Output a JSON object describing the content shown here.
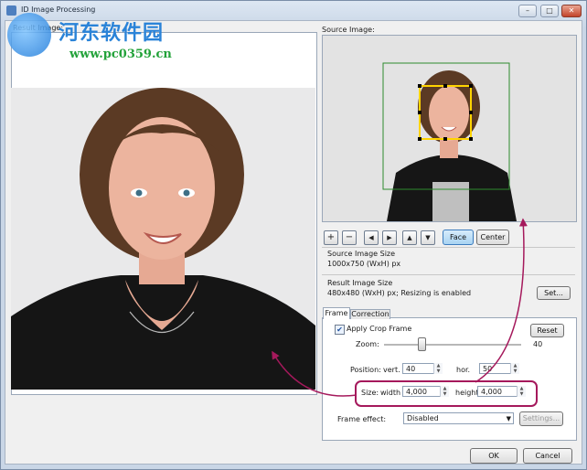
{
  "window": {
    "title": "ID Image Processing",
    "min_label": "–",
    "max_label": "□",
    "close_label": "✕"
  },
  "watermark": {
    "site_name": "河东软件园",
    "url": "www.pc0359.cn"
  },
  "result_panel": {
    "label": "Result Image:"
  },
  "source_panel": {
    "label": "Source Image:"
  },
  "toolbar": {
    "zoom_in": "+",
    "zoom_out": "−",
    "left": "◀",
    "right": "▶",
    "up": "▲",
    "down": "▼",
    "face": "Face",
    "center": "Center"
  },
  "source_size": {
    "label": "Source Image Size",
    "value": "1000x750 (WxH) px"
  },
  "result_size": {
    "label": "Result Image Size",
    "value": "480x480 (WxH) px; Resizing is enabled",
    "set_button": "Set..."
  },
  "tabs": [
    {
      "label": "Frame"
    },
    {
      "label": "Correction"
    }
  ],
  "frame": {
    "apply_crop_label": "Apply Crop Frame",
    "apply_crop_checked": true,
    "reset_button": "Reset",
    "zoom_label": "Zoom:",
    "zoom_value": "40",
    "position_label": "Position:",
    "vert_label": "vert.",
    "vert_value": "40",
    "hor_label": "hor.",
    "hor_value": "50",
    "size_label": "Size:",
    "width_label": "width",
    "width_value": "4,000",
    "height_label": "height",
    "height_value": "4,000",
    "frame_effect_label": "Frame effect:",
    "frame_effect_value": "Disabled",
    "settings_button": "Settings..."
  },
  "footer": {
    "ok": "OK",
    "cancel": "Cancel"
  },
  "colors": {
    "accent": "#3b7bbd",
    "annotation": "#a5195c",
    "crop_frame": "#2e8b2e",
    "face_box": "#ffd400"
  }
}
